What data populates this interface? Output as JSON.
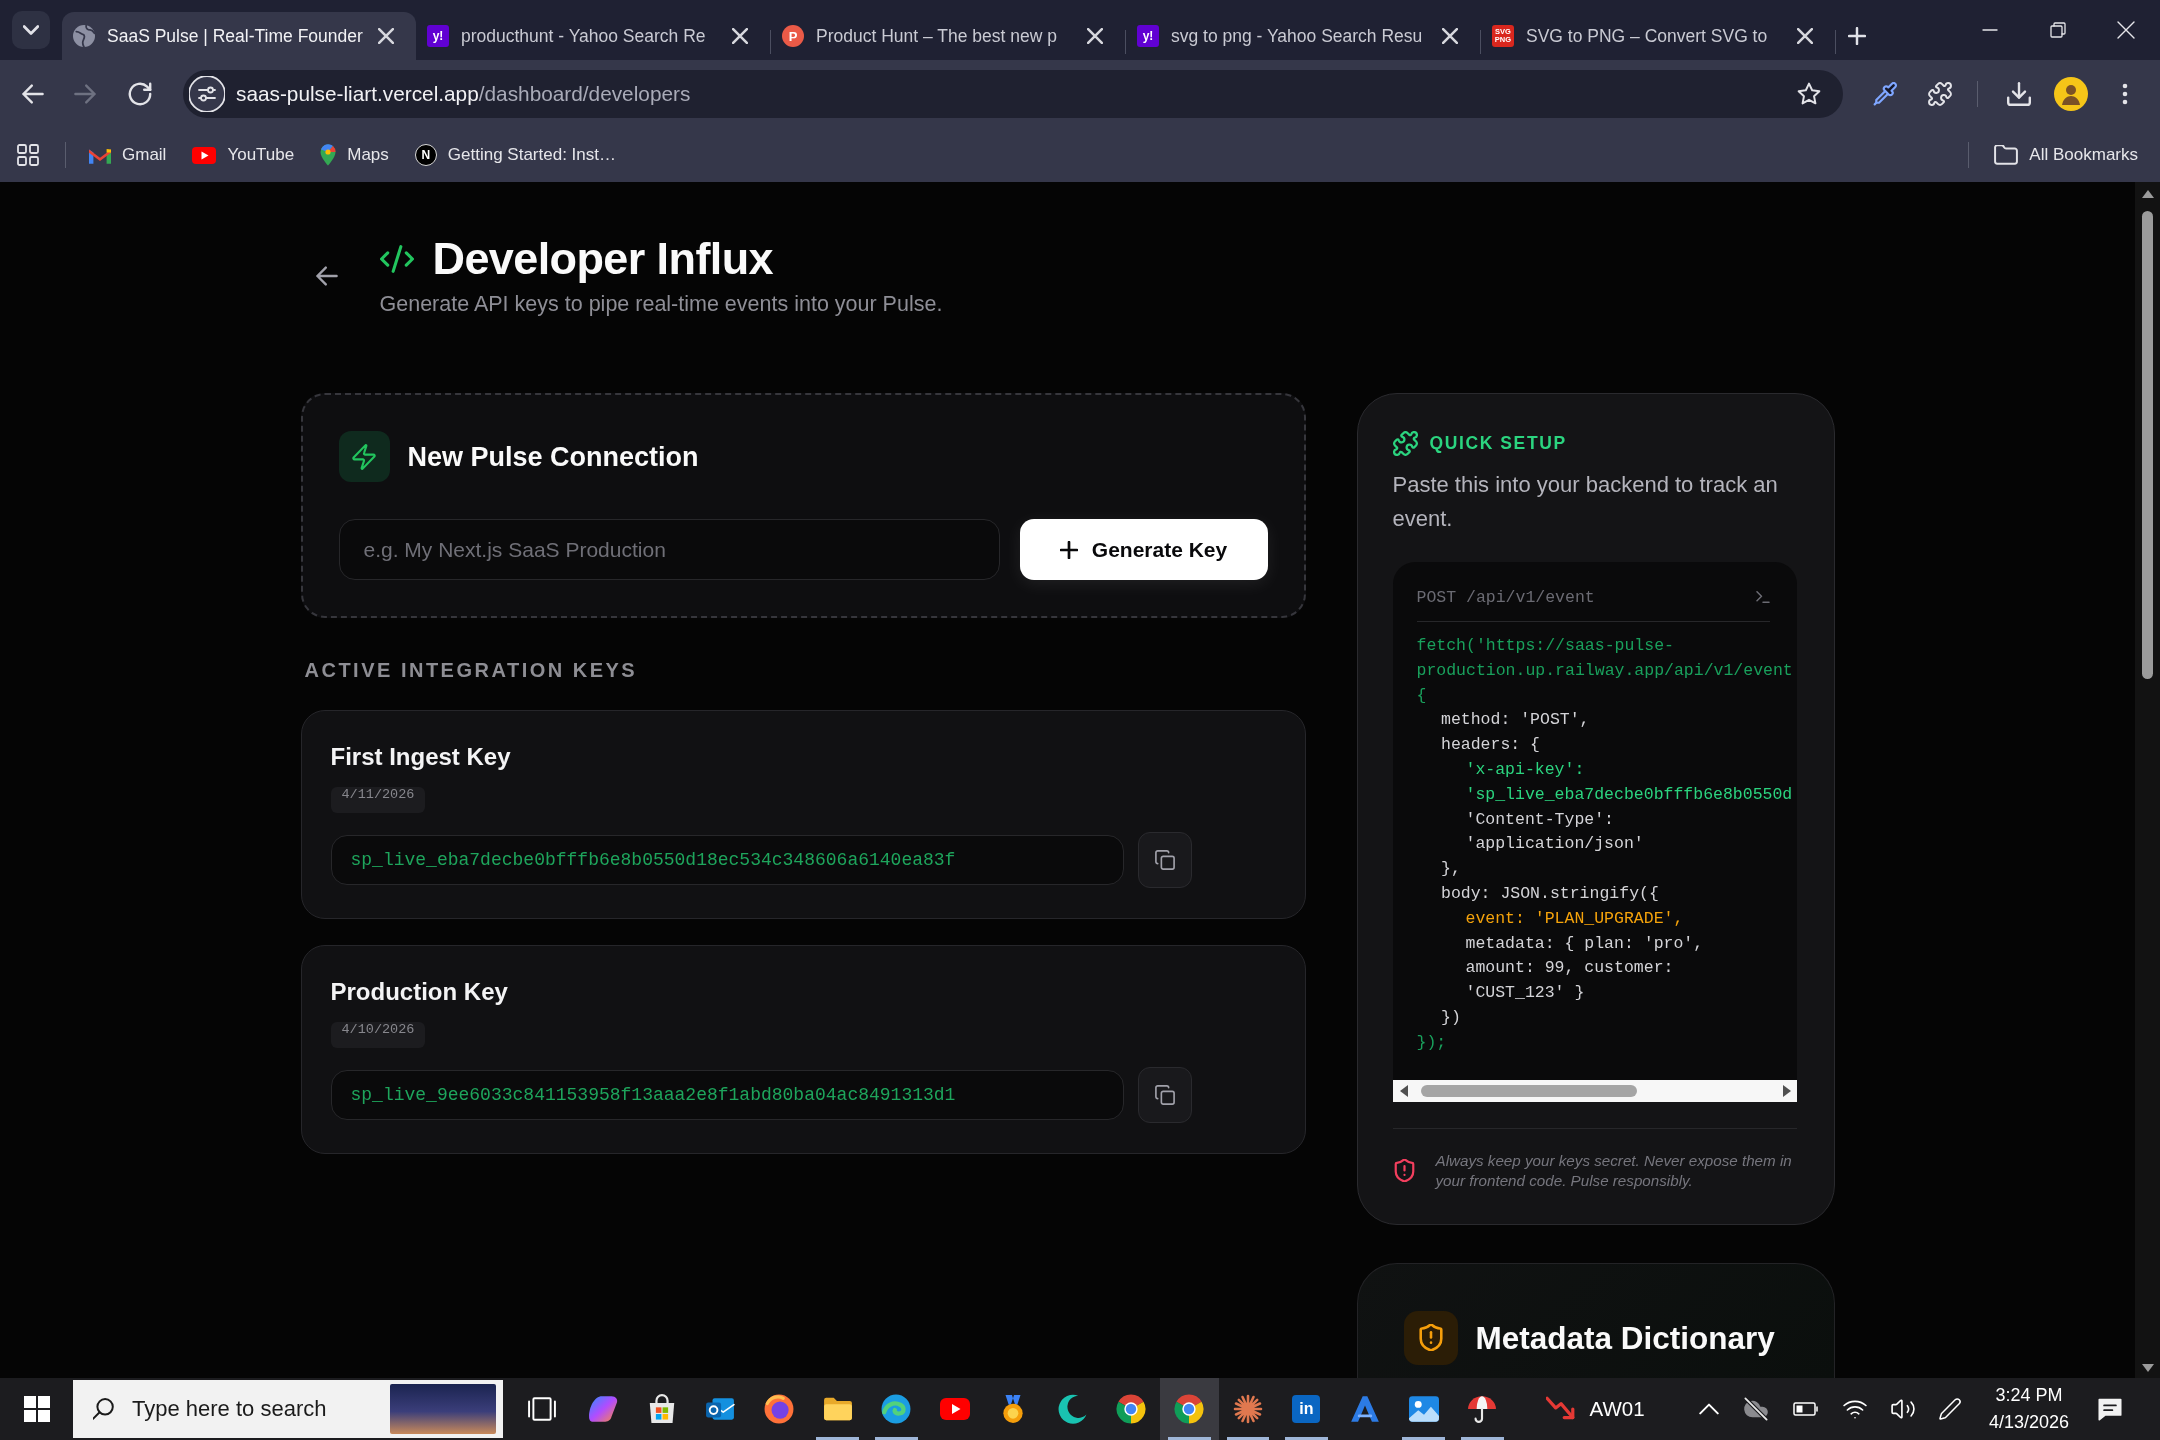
{
  "browser": {
    "tabs": [
      {
        "title": "SaaS Pulse | Real-Time Founder",
        "kind": "globe",
        "selected": true
      },
      {
        "title": "producthunt - Yahoo Search Re",
        "kind": "square",
        "favicon_text": "y!",
        "color": "#6001d2",
        "selected": false
      },
      {
        "title": "Product Hunt – The best new p",
        "kind": "circle",
        "favicon_text": "P",
        "color": "#ea5a47",
        "selected": false
      },
      {
        "title": "svg to png - Yahoo Search Resu",
        "kind": "square",
        "favicon_text": "y!",
        "color": "#6001d2",
        "selected": false
      },
      {
        "title": "SVG to PNG – Convert SVG to",
        "kind": "square",
        "favicon_text": "SVG PNG",
        "color": "#d9271e",
        "selected": false
      }
    ],
    "navigation": {
      "back_disabled": false,
      "forward_disabled": true
    },
    "address": {
      "host": "saas-pulse-liart.vercel.app",
      "path": "/dashboard/developers"
    },
    "bookmarks": [
      {
        "label": "Gmail",
        "kind": "mail"
      },
      {
        "label": "YouTube",
        "kind": "play"
      },
      {
        "label": "Maps",
        "kind": "pin"
      },
      {
        "label": "Getting Started: Inst…",
        "kind": "letter",
        "favicon_text": "N"
      }
    ],
    "all_bookmarks": "All Bookmarks"
  },
  "page": {
    "title": "Developer Influx",
    "subtitle": "Generate API keys to pipe real-time events into your Pulse.",
    "new_connection": {
      "title": "New Pulse Connection",
      "name_field": {
        "placeholder": "e.g. My Next.js SaaS Production"
      },
      "generate_button": "Generate Key"
    },
    "active_keys": {
      "heading": "ACTIVE INTEGRATION KEYS",
      "keys": [
        {
          "name": "First Ingest Key",
          "created": "4/11/2026",
          "key": "sp_live_eba7decbe0bfffb6e8b0550d18ec534c348606a6140ea83f"
        },
        {
          "name": "Production Key",
          "created": "4/10/2026",
          "key": "sp_live_9ee6033c841153958f13aaa2e8f1abd80ba04ac8491313d1"
        }
      ]
    },
    "quick_setup": {
      "heading": "QUICK SETUP",
      "description": "Paste this into your backend to track an event.",
      "code": {
        "endpoint": "POST /api/v1/event",
        "lines": [
          {
            "kind": "url",
            "text": "fetch('https://saas-pulse-"
          },
          {
            "kind": "url",
            "text": "production.up.railway.app/api/v1/event"
          },
          {
            "kind": "url",
            "text": "{",
            "children": [
              {
                "kind": "plain",
                "text": "method: 'POST',"
              },
              {
                "kind": "plain",
                "text": "headers: {",
                "children": [
                  {
                    "kind": "key",
                    "text": "'x-api-key':"
                  },
                  {
                    "kind": "key",
                    "text": "'sp_live_eba7decbe0bfffb6e8b0550d"
                  },
                  {
                    "kind": "plain",
                    "text": "'Content-Type':"
                  },
                  {
                    "kind": "plain",
                    "text": "'application/json'"
                  }
                ]
              },
              {
                "kind": "plain",
                "text": "},"
              },
              {
                "kind": "plain",
                "text": "body: JSON.stringify({",
                "children": [
                  {
                    "kind": "accent",
                    "text": "event: 'PLAN_UPGRADE',"
                  },
                  {
                    "kind": "plain",
                    "text": "metadata: { plan: 'pro',"
                  },
                  {
                    "kind": "plain",
                    "text": "amount: 99, customer:"
                  },
                  {
                    "kind": "plain",
                    "text": "'CUST_123' }"
                  }
                ]
              },
              {
                "kind": "plain",
                "text": "})"
              }
            ]
          },
          {
            "kind": "url",
            "text": "});"
          }
        ]
      },
      "warning": "Always keep your keys secret. Never expose them in your frontend code. Pulse responsibly."
    },
    "metadata_dictionary": {
      "title": "Metadata Dictionary"
    }
  },
  "taskbar": {
    "search": {
      "placeholder": "Type here to search"
    },
    "apps": [
      {
        "kind": "swirl",
        "running": false,
        "selected": false
      },
      {
        "kind": "bag",
        "running": false,
        "selected": false
      },
      {
        "kind": "mail",
        "running": false,
        "selected": false
      },
      {
        "kind": "fox",
        "running": false,
        "selected": false
      },
      {
        "kind": "folder",
        "running": true,
        "selected": false
      },
      {
        "kind": "wave",
        "running": true,
        "selected": false
      },
      {
        "kind": "play",
        "running": false,
        "selected": false
      },
      {
        "kind": "medal",
        "running": false,
        "selected": false
      },
      {
        "kind": "crescent",
        "running": false,
        "selected": false
      },
      {
        "kind": "orb",
        "running": false,
        "selected": false
      },
      {
        "kind": "orb",
        "running": true,
        "selected": true
      },
      {
        "kind": "burst",
        "running": true,
        "selected": false
      },
      {
        "kind": "tile",
        "icon_text": "in",
        "running": true,
        "selected": false
      },
      {
        "kind": "peak",
        "running": false,
        "selected": false
      },
      {
        "kind": "picture",
        "running": true,
        "selected": false
      },
      {
        "kind": "umbrella",
        "running": true,
        "selected": false
      },
      {
        "kind": "chart",
        "label": "AW01",
        "running": false,
        "selected": false
      }
    ],
    "clock": {
      "time": "3:24 PM",
      "date": "4/13/2026"
    }
  }
}
